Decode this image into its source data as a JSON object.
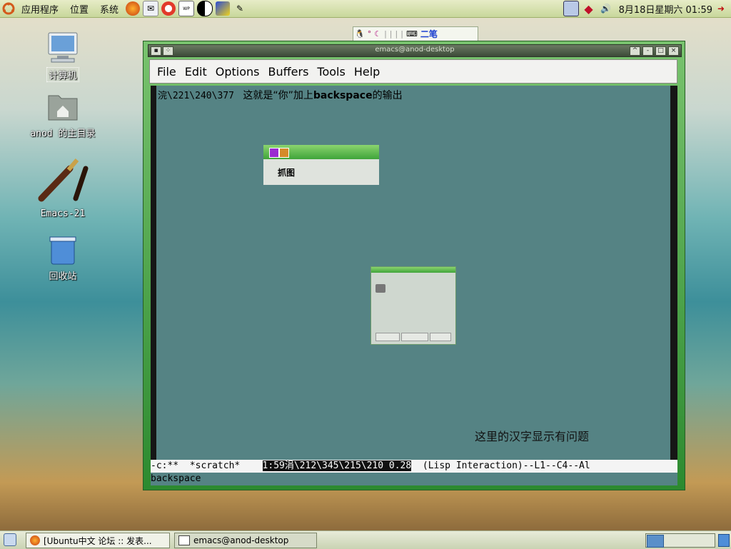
{
  "top_panel": {
    "menus": [
      "应用程序",
      "位置",
      "系统"
    ],
    "launchers": [
      "firefox-icon",
      "mail-icon",
      "help-icon",
      "wordprocessor-icon",
      "yinyang-icon",
      "graphics-icon",
      "pen-icon"
    ],
    "clock": "8月18日星期六 01:59"
  },
  "desktop": {
    "icons": [
      {
        "label": "计算机"
      },
      {
        "label": "anod 的主目录"
      },
      {
        "label": "Emacs-21"
      },
      {
        "label": "回收站"
      }
    ]
  },
  "ime": {
    "mode": "二笔"
  },
  "emacs": {
    "title": "emacs@anod-desktop",
    "menus": [
      "File",
      "Edit",
      "Options",
      "Buffers",
      "Tools",
      "Help"
    ],
    "line1_escape": "浣\\221\\240\\377",
    "line1_text_a": "这就是“你”加上",
    "line1_text_bold": "backspace",
    "line1_text_b": "的输出",
    "chinese_note": "这里的汉字显示有问题",
    "fragment_title": "抓图",
    "modeline_left": "-c:**  *scratch*    ",
    "modeline_mid": "1:59涓\\212\\345\\215\\210 0.28",
    "modeline_right": "  (Lisp Interaction)--L1--C4--Al",
    "minibuffer": "  backspace"
  },
  "taskbar": {
    "tasks": [
      {
        "label": "[Ubuntu中文 论坛 :: 发表..."
      },
      {
        "label": "emacs@anod-desktop"
      }
    ]
  }
}
